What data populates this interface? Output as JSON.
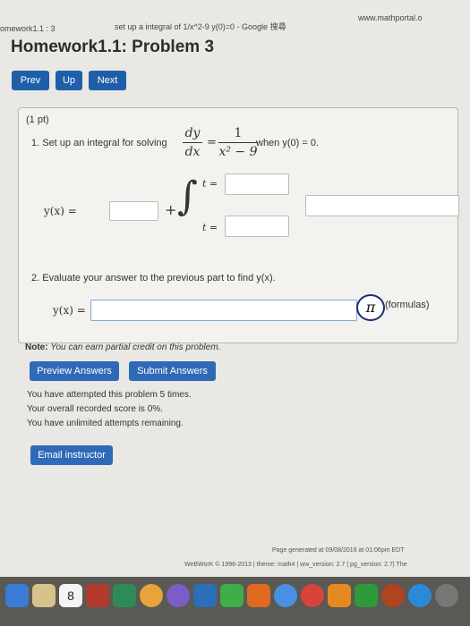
{
  "browser": {
    "tab_left": "omework1.1 : 3",
    "tab_middle": "set up a integral of 1/x^2-9 y(0)=0 - Google 搜尋",
    "tab_right": "www.mathportal.o"
  },
  "page": {
    "title": "Homework1.1: Problem 3"
  },
  "nav": {
    "prev": "Prev",
    "up": "Up",
    "next": "Next"
  },
  "problem": {
    "points": "(1 pt)",
    "q1_text": "1. Set up an integral for solving",
    "q1_frac_num": "dy",
    "q1_frac_den": "dx",
    "q1_equals": "=",
    "q1_rhs_num": "1",
    "q1_rhs_den": "x² − 9",
    "q1_condition": "when y(0) = 0.",
    "yx_label": "y(x) =",
    "plus": "+",
    "upper_label": "t =",
    "lower_label": "t =",
    "q2_text": "2. Evaluate your answer to the previous part to find y(x).",
    "yx2_label": "y(x) =",
    "pi_symbol": "π",
    "formulas_label": "(formulas)"
  },
  "note": {
    "label": "Note:",
    "text": "You can earn partial credit on this problem."
  },
  "actions": {
    "preview": "Preview Answers",
    "submit": "Submit Answers"
  },
  "attempts": {
    "line1": "You have attempted this problem 5 times.",
    "line2": "Your overall recorded score is 0%.",
    "line3": "You have unlimited attempts remaining."
  },
  "email_button": "Email instructor",
  "footer": {
    "generated": "Page generated at 09/08/2016 at 01:06pm EDT",
    "copyright": "WeBWorK © 1996-2013 | theme: math4 | ww_version: 2.7 | pg_version: 2.7| The"
  },
  "dock": {
    "calendar_day": "8"
  }
}
